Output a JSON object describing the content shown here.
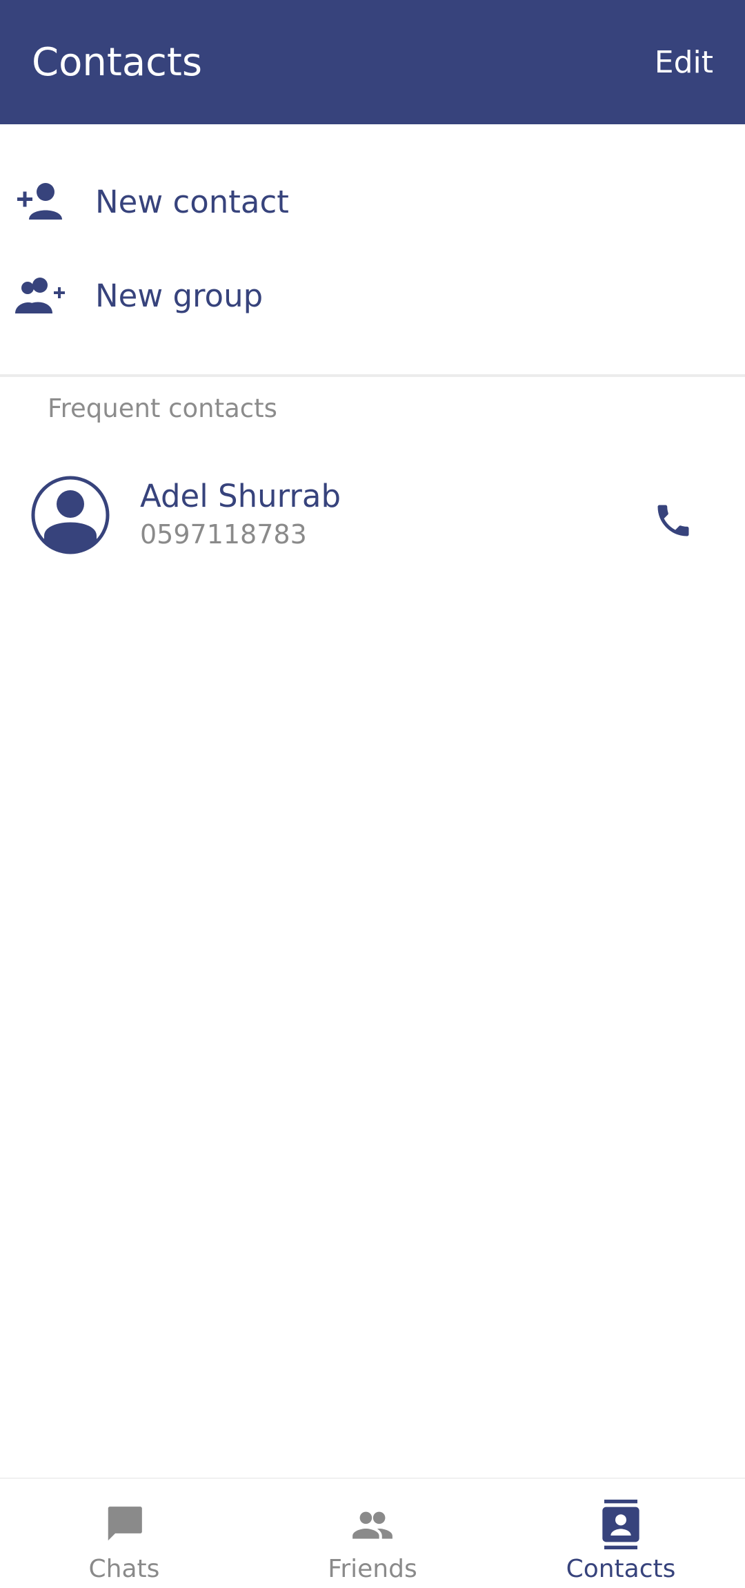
{
  "colors": {
    "primary": "#37437c",
    "inactive": "#8a8a8a",
    "background": "#ffffff"
  },
  "header": {
    "title": "Contacts",
    "edit_label": "Edit"
  },
  "actions": [
    {
      "label": "New contact",
      "icon": "person-add-icon"
    },
    {
      "label": "New group",
      "icon": "group-add-icon"
    }
  ],
  "frequent": {
    "section_title": "Frequent contacts",
    "contacts": [
      {
        "name": "Adel Shurrab",
        "phone": "0597118783",
        "avatar_icon": "avatar-icon",
        "action_icon": "phone-icon"
      }
    ]
  },
  "bottom_nav": {
    "items": [
      {
        "label": "Chats",
        "icon": "chat-icon",
        "active": false
      },
      {
        "label": "Friends",
        "icon": "friends-icon",
        "active": false
      },
      {
        "label": "Contacts",
        "icon": "contacts-book-icon",
        "active": true
      }
    ]
  }
}
